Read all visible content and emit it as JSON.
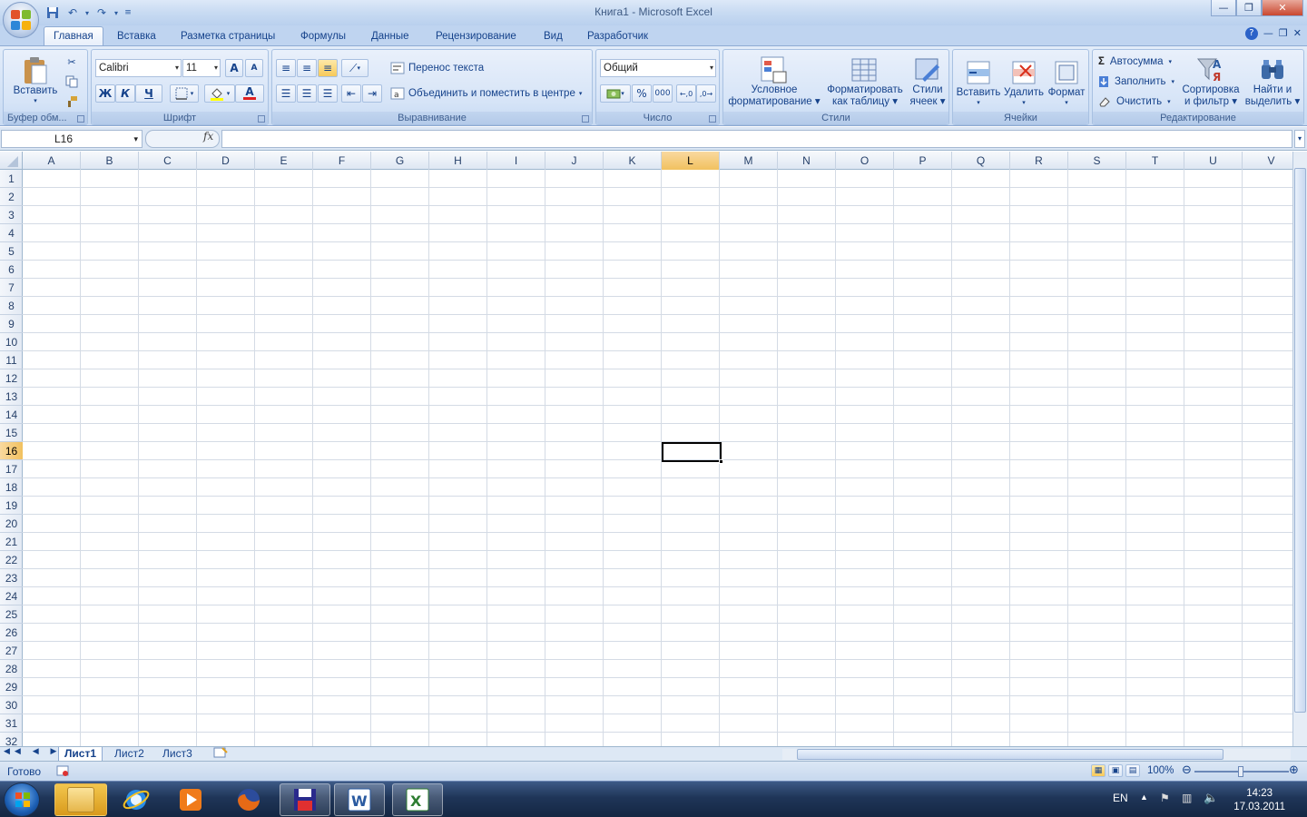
{
  "window": {
    "title": "Книга1 - Microsoft Excel"
  },
  "tabs": [
    "Главная",
    "Вставка",
    "Разметка страницы",
    "Формулы",
    "Данные",
    "Рецензирование",
    "Вид",
    "Разработчик"
  ],
  "clipboard": {
    "paste": "Вставить",
    "group": "Буфер обм..."
  },
  "font": {
    "name": "Calibri",
    "size": "11",
    "bold": "Ж",
    "italic": "К",
    "underline": "Ч",
    "grow": "A",
    "shrink": "A",
    "fontcolor": "A",
    "group": "Шрифт"
  },
  "alignment": {
    "wrap": "Перенос текста",
    "merge": "Объединить и поместить в центре",
    "group": "Выравнивание"
  },
  "number": {
    "format": "Общий",
    "percent": "%",
    "thousands": "000",
    "group": "Число"
  },
  "styles": {
    "conditional": "Условное",
    "conditional2": "форматирование",
    "astable": "Форматировать",
    "astable2": "как таблицу",
    "cellstyles": "Стили",
    "cellstyles2": "ячеек",
    "group": "Стили"
  },
  "cells": {
    "insert": "Вставить",
    "delete": "Удалить",
    "format": "Формат",
    "group": "Ячейки"
  },
  "editing": {
    "autosum": "Автосумма",
    "fill": "Заполнить",
    "clear": "Очистить",
    "sort": "Сортировка",
    "sort2": "и фильтр",
    "find": "Найти и",
    "find2": "выделить",
    "group": "Редактирование",
    "sigma": "Σ"
  },
  "formula": {
    "namebox": "L16",
    "fx": "fx",
    "value": ""
  },
  "columns": [
    "A",
    "B",
    "C",
    "D",
    "E",
    "F",
    "G",
    "H",
    "I",
    "J",
    "K",
    "L",
    "M",
    "N",
    "O",
    "P",
    "Q",
    "R",
    "S",
    "T",
    "U",
    "V"
  ],
  "rows": [
    "1",
    "2",
    "3",
    "4",
    "5",
    "6",
    "7",
    "8",
    "9",
    "10",
    "11",
    "12",
    "13",
    "14",
    "15",
    "16",
    "17",
    "18",
    "19",
    "20",
    "21",
    "22",
    "23",
    "24",
    "25",
    "26",
    "27",
    "28",
    "29",
    "30",
    "31",
    "32"
  ],
  "selection": {
    "column": "L",
    "row": "16"
  },
  "sheets": [
    "Лист1",
    "Лист2",
    "Лист3"
  ],
  "status": {
    "text": "Готово",
    "zoom": "100%"
  },
  "tray": {
    "lang": "EN",
    "time": "14:23",
    "date": "17.03.2011"
  },
  "colors": {
    "accent": "#15428b",
    "selection_header": "#f1c15f"
  }
}
